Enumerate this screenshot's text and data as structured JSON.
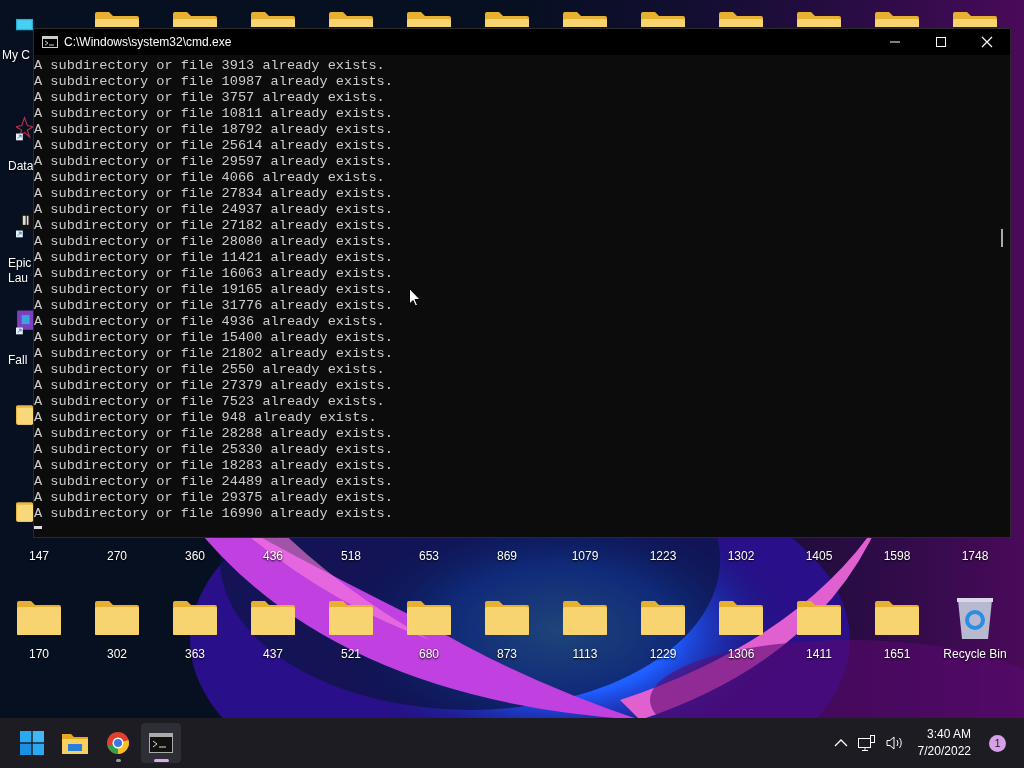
{
  "desktop": {
    "left_icons": [
      {
        "kind": "computer",
        "label": [
          "My C"
        ]
      },
      {
        "kind": "data",
        "label": [
          "Data"
        ]
      },
      {
        "kind": "epic",
        "label": [
          "Epic",
          "Lau"
        ]
      },
      {
        "kind": "game",
        "label": [
          "Fall"
        ]
      },
      {
        "kind": "folder"
      },
      {
        "kind": "folder"
      }
    ],
    "upper_labels": [
      "147",
      "270",
      "360",
      "436",
      "518",
      "653",
      "869",
      "1079",
      "1223",
      "1302",
      "1405",
      "1598",
      "1748"
    ],
    "folders": [
      "170",
      "302",
      "363",
      "437",
      "521",
      "680",
      "873",
      "1113",
      "1229",
      "1306",
      "1411",
      "1651"
    ],
    "recycle_bin": "Recycle Bin"
  },
  "window": {
    "title": "C:\\Windows\\system32\\cmd.exe",
    "lines": [
      "A subdirectory or file 3913 already exists.",
      "A subdirectory or file 10987 already exists.",
      "A subdirectory or file 3757 already exists.",
      "A subdirectory or file 10811 already exists.",
      "A subdirectory or file 18792 already exists.",
      "A subdirectory or file 25614 already exists.",
      "A subdirectory or file 29597 already exists.",
      "A subdirectory or file 4066 already exists.",
      "A subdirectory or file 27834 already exists.",
      "A subdirectory or file 24937 already exists.",
      "A subdirectory or file 27182 already exists.",
      "A subdirectory or file 28080 already exists.",
      "A subdirectory or file 11421 already exists.",
      "A subdirectory or file 16063 already exists.",
      "A subdirectory or file 19165 already exists.",
      "A subdirectory or file 31776 already exists.",
      "A subdirectory or file 4936 already exists.",
      "A subdirectory or file 15400 already exists.",
      "A subdirectory or file 21802 already exists.",
      "A subdirectory or file 2550 already exists.",
      "A subdirectory or file 27379 already exists.",
      "A subdirectory or file 7523 already exists.",
      "A subdirectory or file 948 already exists.",
      "A subdirectory or file 28288 already exists.",
      "A subdirectory or file 25330 already exists.",
      "A subdirectory or file 18283 already exists.",
      "A subdirectory or file 24489 already exists.",
      "A subdirectory or file 29375 already exists.",
      "A subdirectory or file 16990 already exists."
    ]
  },
  "taskbar": {
    "apps": [
      {
        "kind": "start",
        "running": false,
        "selected": false
      },
      {
        "kind": "explorer",
        "running": false,
        "selected": false
      },
      {
        "kind": "browser",
        "running": true,
        "selected": false
      },
      {
        "kind": "terminal",
        "running": true,
        "selected": true
      }
    ],
    "time": "3:40 AM",
    "date": "7/20/2022",
    "notifications": "1"
  }
}
